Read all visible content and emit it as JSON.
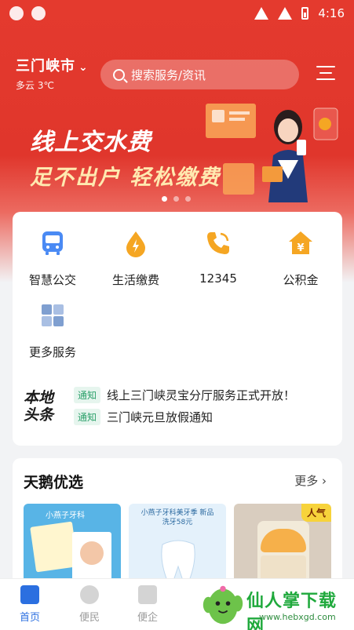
{
  "status_bar": {
    "time": "4:16"
  },
  "header": {
    "city": "三门峡市",
    "weather": "多云 3℃",
    "search_placeholder": "搜索服务/资讯"
  },
  "banner": {
    "title": "线上交水费",
    "subtitle": "足不出户 轻松缴费",
    "slide_count": 3,
    "active_slide": 1
  },
  "services": [
    {
      "label": "智慧公交",
      "icon": "bus-icon",
      "color": "#4a8af4"
    },
    {
      "label": "生活缴费",
      "icon": "water-drop-icon",
      "color": "#f5a623"
    },
    {
      "label": "12345",
      "icon": "phone-icon",
      "color": "#f5a623"
    },
    {
      "label": "公积金",
      "icon": "house-yuan-icon",
      "color": "#f5a623"
    },
    {
      "label": "更多服务",
      "icon": "grid-icon",
      "color": "#7f9fd0"
    }
  ],
  "local_news": {
    "logo": "本地头条",
    "items": [
      {
        "tag": "通知",
        "text": "线上三门峡灵宝分厅服务正式开放！"
      },
      {
        "tag": "通知",
        "text": "三门峡元旦放假通知"
      }
    ]
  },
  "mall": {
    "title": "天鹅优选",
    "more": "更多",
    "products": [
      {
        "caption": "小燕子牙科",
        "badge": ""
      },
      {
        "caption": "小燕子牙科美牙季 新品洗牙58元",
        "badge": ""
      },
      {
        "caption": "",
        "badge": "人气"
      }
    ]
  },
  "tabbar": [
    {
      "label": "首页",
      "active": true
    },
    {
      "label": "便民",
      "active": false
    },
    {
      "label": "便企",
      "active": false
    }
  ],
  "watermark": {
    "text": "仙人掌下载网",
    "url": "www.hebxgd.com"
  }
}
